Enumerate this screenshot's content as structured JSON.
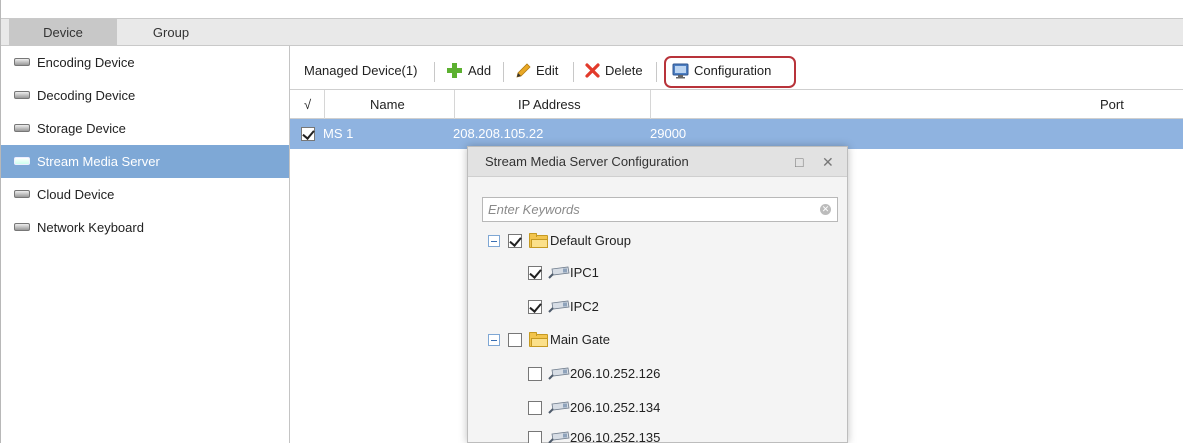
{
  "tabs": [
    {
      "label": "Device",
      "active": true
    },
    {
      "label": "Group",
      "active": false
    }
  ],
  "sidebar": {
    "items": [
      {
        "label": "Encoding Device",
        "icon": "device-icon"
      },
      {
        "label": "Decoding Device",
        "icon": "device-icon"
      },
      {
        "label": "Storage Device",
        "icon": "device-icon"
      },
      {
        "label": "Stream Media Server",
        "icon": "server-icon",
        "active": true
      },
      {
        "label": "Cloud Device",
        "icon": "device-icon"
      },
      {
        "label": "Network Keyboard",
        "icon": "keyboard-icon"
      }
    ]
  },
  "toolbar": {
    "managed_label": "Managed Device(1)",
    "add_label": "Add",
    "edit_label": "Edit",
    "delete_label": "Delete",
    "configuration_label": "Configuration"
  },
  "table": {
    "headers": {
      "check": "√",
      "name": "Name",
      "ip": "IP Address",
      "port": "Port"
    },
    "rows": [
      {
        "checked": true,
        "name": "MS 1",
        "ip": "208.208.105.22",
        "port": "29000"
      }
    ]
  },
  "dialog": {
    "title": "Stream Media Server Configuration",
    "maximize_icon": "□",
    "close_icon": "✕",
    "search_placeholder": "Enter Keywords",
    "tree": [
      {
        "type": "group",
        "label": "Default Group",
        "checked": true,
        "expanded": true
      },
      {
        "type": "camera",
        "label": "IPC1",
        "checked": true
      },
      {
        "type": "camera",
        "label": "IPC2",
        "checked": true
      },
      {
        "type": "group",
        "label": "Main Gate",
        "checked": false,
        "expanded": true
      },
      {
        "type": "camera",
        "label": "206.10.252.126",
        "checked": false
      },
      {
        "type": "camera",
        "label": "206.10.252.134",
        "checked": false
      },
      {
        "type": "camera",
        "label": "206.10.252.135",
        "checked": false
      }
    ]
  },
  "colors": {
    "selection": "#8fb3e0",
    "sidebar_active": "#7ea8d6",
    "highlight": "#b8333a"
  }
}
